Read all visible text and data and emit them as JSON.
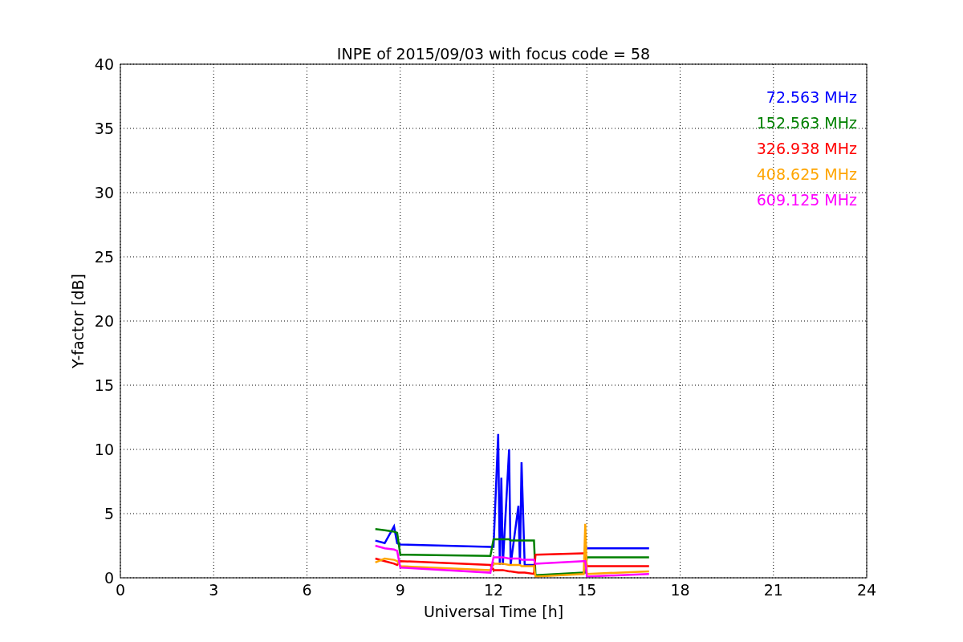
{
  "chart_data": {
    "type": "line",
    "title": "INPE of 2015/09/03 with focus code = 58",
    "xlabel": "Universal Time [h]",
    "ylabel": "Y-factor [dB]",
    "x": [
      8.2,
      8.5,
      8.8,
      8.9,
      9.0,
      11.9,
      12.0,
      12.15,
      12.2,
      12.25,
      12.3,
      12.5,
      12.55,
      12.8,
      12.85,
      12.9,
      13.0,
      13.3,
      13.35,
      14.9,
      14.95,
      15.0,
      17.0
    ],
    "series": [
      {
        "name": "72.563 MHz",
        "color": "#0000ff",
        "values": [
          2.9,
          2.7,
          4.0,
          2.7,
          2.6,
          2.4,
          2.4,
          11.2,
          1.0,
          7.8,
          1.0,
          10.0,
          1.0,
          5.6,
          1.0,
          9.0,
          1.0,
          1.0,
          null,
          null,
          null,
          2.3,
          2.3
        ]
      },
      {
        "name": "152.563 MHz",
        "color": "#008000",
        "values": [
          3.8,
          3.7,
          3.6,
          3.5,
          1.8,
          1.7,
          3.0,
          3.0,
          3.0,
          3.0,
          3.0,
          3.0,
          2.9,
          2.9,
          2.9,
          2.9,
          2.9,
          2.9,
          0.2,
          0.4,
          0.4,
          1.6,
          1.6
        ]
      },
      {
        "name": "326.938 MHz",
        "color": "#ff0000",
        "values": [
          1.5,
          1.3,
          1.1,
          1.0,
          1.3,
          1.0,
          0.6,
          0.6,
          0.6,
          0.6,
          0.6,
          0.5,
          0.5,
          0.4,
          0.4,
          0.4,
          0.4,
          0.3,
          1.8,
          1.9,
          1.9,
          0.9,
          0.9
        ]
      },
      {
        "name": "408.625 MHz",
        "color": "#ffa500",
        "values": [
          1.2,
          1.5,
          1.4,
          1.3,
          0.9,
          0.6,
          1.1,
          1.1,
          1.1,
          1.1,
          1.1,
          1.0,
          1.0,
          1.0,
          1.0,
          0.9,
          0.9,
          0.9,
          0.1,
          0.3,
          4.2,
          0.3,
          0.5
        ]
      },
      {
        "name": "609.125 MHz",
        "color": "#ff00ff",
        "values": [
          2.5,
          2.3,
          2.2,
          2.1,
          0.8,
          0.4,
          1.6,
          1.6,
          1.6,
          1.6,
          1.6,
          1.5,
          1.5,
          1.5,
          1.5,
          1.4,
          1.4,
          1.4,
          1.1,
          1.3,
          1.3,
          0.1,
          0.3
        ]
      }
    ],
    "grid": true,
    "xlim": [
      0,
      24
    ],
    "ylim": [
      0,
      40
    ],
    "xticks": [
      0,
      3,
      6,
      9,
      12,
      15,
      18,
      21,
      24
    ],
    "yticks": [
      0,
      5,
      10,
      15,
      20,
      25,
      30,
      35,
      40
    ]
  }
}
